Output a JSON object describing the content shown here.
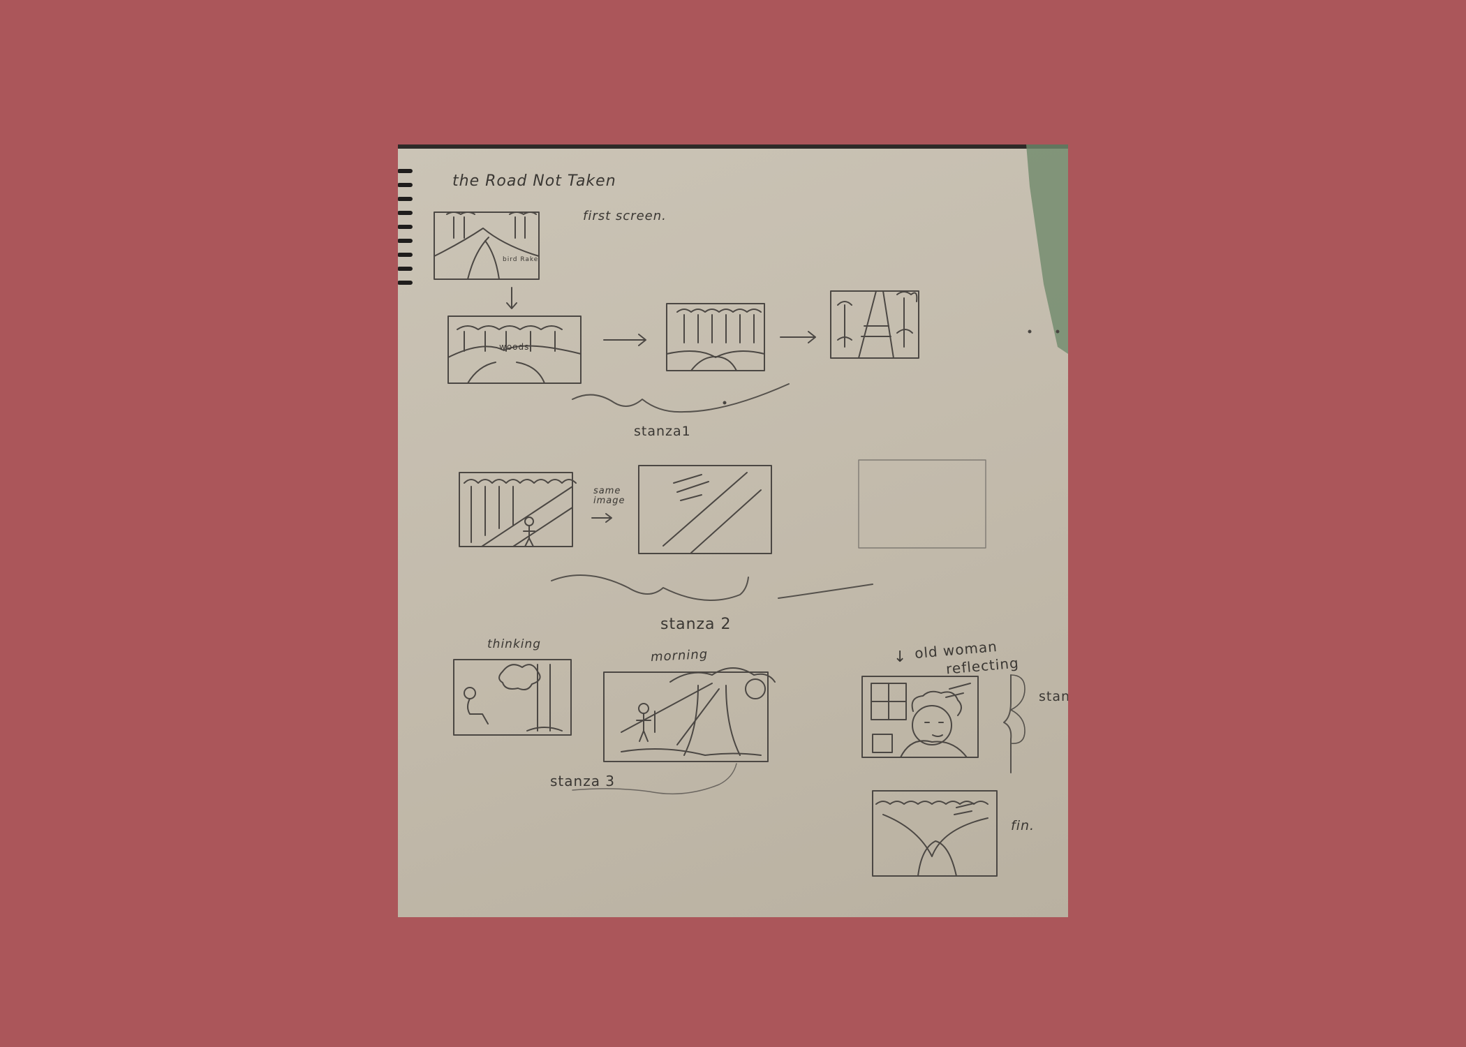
{
  "sketch": {
    "title": "the Road Not Taken",
    "panel_first_caption": "first screen.",
    "panel_first_inner": "bird Rake",
    "panel2_word": "woods",
    "stanza1": "stanza1",
    "same_image": "same image",
    "stanza2": "stanza 2",
    "thinking": "thinking",
    "morning": "morning",
    "stanza3": "stanza 3",
    "old_woman": "old woman",
    "reflecting": "reflecting",
    "stanza4_partial": "stan",
    "fin": "fin."
  },
  "colors": {
    "background": "#ab565a",
    "paper": "#c6bfb1",
    "pencil": "#3a3733"
  }
}
